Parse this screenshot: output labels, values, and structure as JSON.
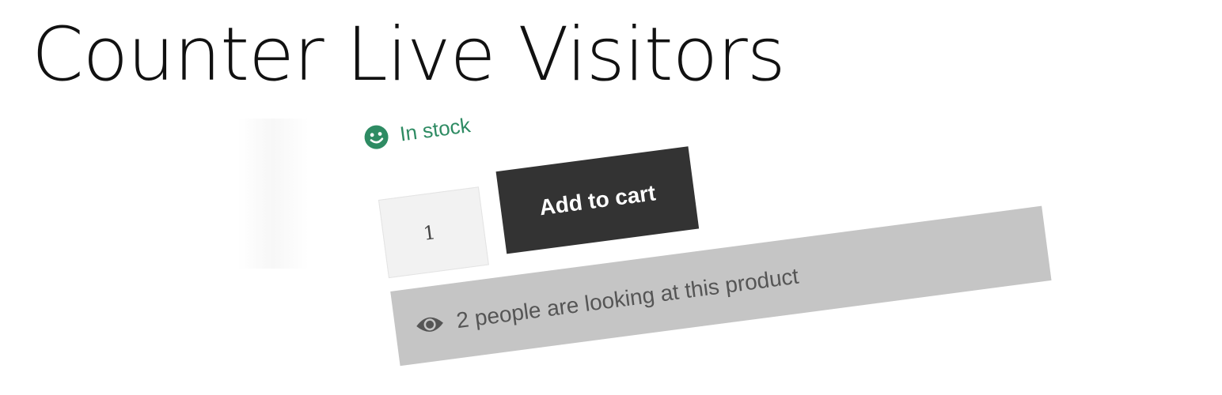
{
  "page": {
    "title": "Counter Live Visitors"
  },
  "product": {
    "stock_status": "In stock",
    "quantity": "1",
    "add_to_cart_label": "Add to cart",
    "live_visitors_text": "2 people are looking at this product"
  },
  "icons": {
    "stock_icon": "smile-icon",
    "visitors_icon": "eye-icon"
  },
  "colors": {
    "stock_green": "#2e8b63",
    "button_bg": "#333333",
    "visitors_bg": "#c5c5c5"
  }
}
